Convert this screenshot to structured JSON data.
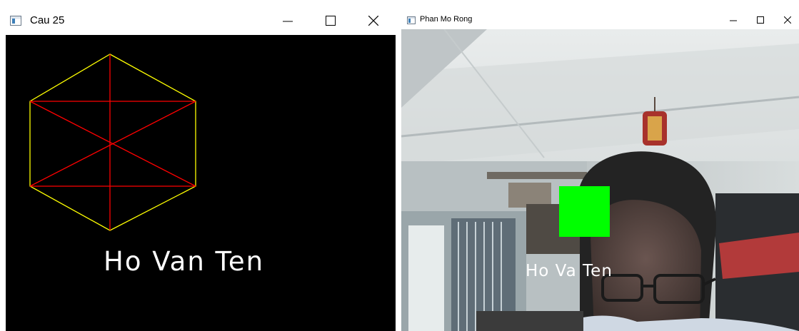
{
  "windows": {
    "left": {
      "title": "Cau 25",
      "canvas_text": "Ho Van Ten",
      "shape_colors": {
        "outline": "#ffff00",
        "diagonals": "#ff0000",
        "background": "#000000"
      }
    },
    "right": {
      "title": "Phan Mo Rong",
      "overlay_text": "Ho Va Ten",
      "overlay_box_color": "#00ff00"
    }
  },
  "icons": {
    "app": "window-app-icon",
    "minimize": "minimize-icon",
    "maximize": "maximize-icon",
    "close": "close-icon"
  }
}
